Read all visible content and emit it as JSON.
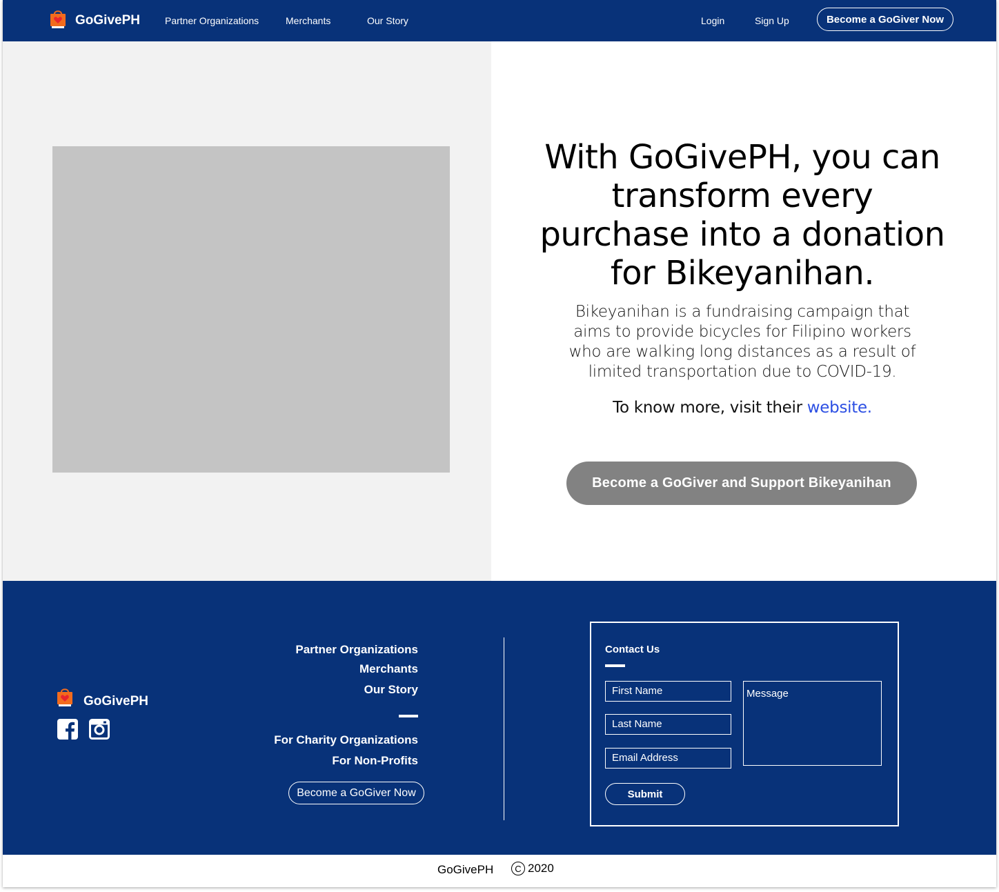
{
  "brand": {
    "name": "GoGivePH"
  },
  "nav": {
    "links": [
      "Partner Organizations",
      "Merchants",
      "Our Story"
    ],
    "login": "Login",
    "signup": "Sign Up",
    "cta": "Become a GoGiver Now"
  },
  "hero": {
    "headline": "With GoGivePH, you can transform every purchase into a donation for Bikeyanihan.",
    "description": "Bikeyanihan is a fundraising campaign that aims to provide bicycles for Filipino workers who are walking long distances as a result of limited transportation due to COVID-19.",
    "more_prefix": "To know more, visit their ",
    "more_link": "website.",
    "support_button": "Become a GoGiver and Support Bikeyanihan"
  },
  "footer": {
    "brand": "GoGivePH",
    "links": [
      "Partner Organizations",
      "Merchants",
      "Our Story"
    ],
    "secondary_links": [
      "For Charity Organizations",
      "For Non-Profits"
    ],
    "cta": "Become a GoGiver Now",
    "contact": {
      "title": "Contact Us",
      "first_name": "First Name",
      "last_name": "Last Name",
      "email": "Email Address",
      "message": "Message",
      "submit": "Submit"
    }
  },
  "bottom": {
    "brand": "GoGivePH",
    "copyright_symbol": "C",
    "year": "2020"
  },
  "colors": {
    "navy": "#083279",
    "link_blue": "#2c4fe3",
    "button_gray": "#828282",
    "image_placeholder": "#c4c4c4"
  },
  "icons": [
    "shopping-bag-heart-icon",
    "facebook-icon",
    "instagram-icon",
    "copyright-icon"
  ]
}
